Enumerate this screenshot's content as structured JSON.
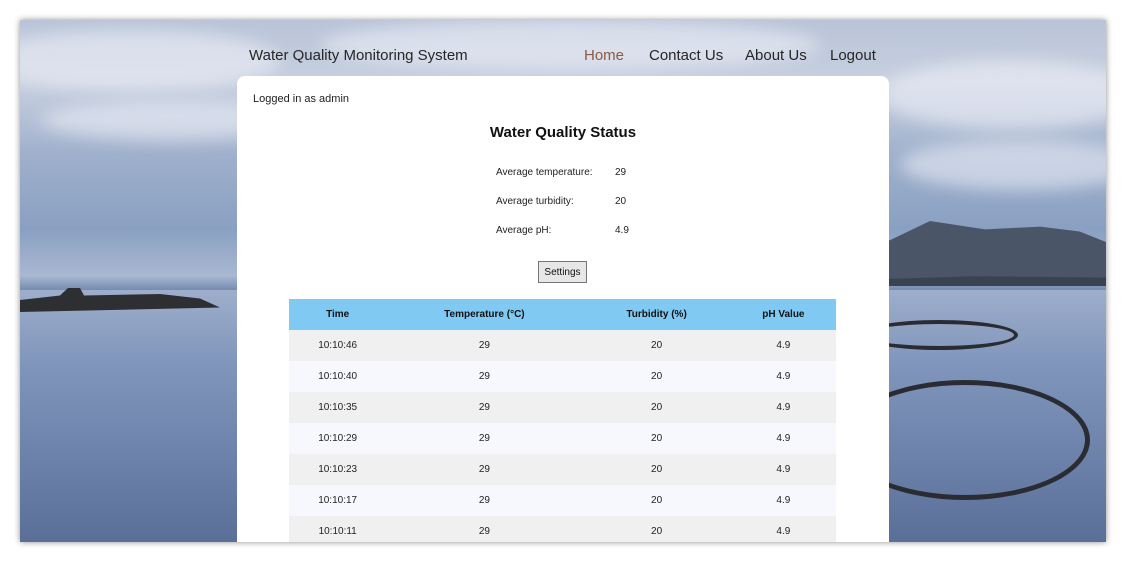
{
  "nav": {
    "brand": "Water Quality Monitoring System",
    "links": [
      "Home",
      "Contact Us",
      "About Us",
      "Logout"
    ],
    "active_color": "#8a5a44"
  },
  "main": {
    "logged_in_text": "Logged in as admin",
    "status_title": "Water Quality Status",
    "stats": [
      {
        "label": "Average temperature:",
        "value": "29"
      },
      {
        "label": "Average turbidity:",
        "value": "20"
      },
      {
        "label": "Average pH:",
        "value": "4.9"
      }
    ],
    "settings_label": "Settings"
  },
  "table": {
    "header_color": "#7fc9f2",
    "columns": [
      "Time",
      "Temperature (°C)",
      "Turbidity (%)",
      "pH Value"
    ],
    "rows": [
      [
        "10:10:46",
        "29",
        "20",
        "4.9"
      ],
      [
        "10:10:40",
        "29",
        "20",
        "4.9"
      ],
      [
        "10:10:35",
        "29",
        "20",
        "4.9"
      ],
      [
        "10:10:29",
        "29",
        "20",
        "4.9"
      ],
      [
        "10:10:23",
        "29",
        "20",
        "4.9"
      ],
      [
        "10:10:17",
        "29",
        "20",
        "4.9"
      ],
      [
        "10:10:11",
        "29",
        "20",
        "4.9"
      ]
    ]
  }
}
